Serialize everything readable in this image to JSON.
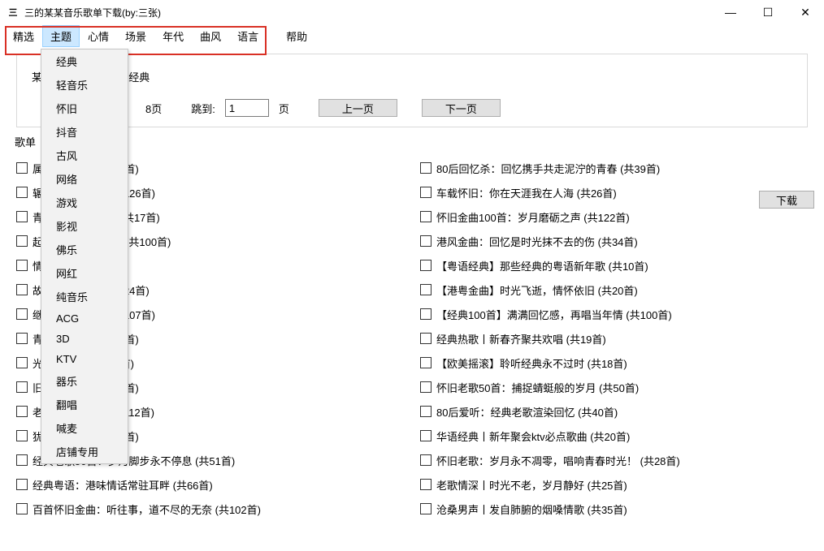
{
  "title": {
    "icon": "三",
    "text": "三的某某音乐歌单下载(by:三张)"
  },
  "win": {
    "min": "—",
    "max": "☐",
    "close": "✕"
  },
  "menubar": {
    "items": [
      "精选",
      "主题",
      "心情",
      "场景",
      "年代",
      "曲风",
      "语言",
      "帮助"
    ],
    "active_index": 1
  },
  "dropdown": {
    "items": [
      "经典",
      "轻音乐",
      "怀旧",
      "抖音",
      "古风",
      "网络",
      "游戏",
      "影视",
      "佛乐",
      "网红",
      "纯音乐",
      "ACG",
      "3D",
      "KTV",
      "器乐",
      "翻唱",
      "喊麦",
      "店铺专用"
    ]
  },
  "panel": {
    "header_prefix": "某某",
    "header_suffix": "经典",
    "page_info_suffix": "8页",
    "jump_label": "跳到:",
    "jump_value": "1",
    "page_suffix_label": "页",
    "prev_label": "上一页",
    "next_label": "下一页"
  },
  "list": {
    "header": "歌单",
    "download_label": "下载",
    "left": [
      "属的光辉岁月   (共32首)",
      "辗转往事岁月轴   (共126首)",
      "青春，遗漏的经典   (共17首)",
      "起高呼Rock 'n' Roll   (共100首)",
      "情至今难忘   (共20首)",
      "故人，谈笑风生   (共24首)",
      "继绻心间的回忆   (共107首)",
      "青涩年华往事   (共50首)",
      "光辉旧流年   (共148首)",
      "旧曲，念旧人   (共19首)",
      "老歌浸润旧年华   (共112首)",
      "犹耳际的回声   (共50首)",
      "经典老歌50首：岁月脚步永不停息   (共51首)",
      "经典粤语：港味情话常驻耳畔   (共66首)",
      "百首怀旧金曲：听往事，道不尽的无奈   (共102首)"
    ],
    "right": [
      "80后回忆杀：回忆携手共走泥泞的青春   (共39首)",
      "车载怀旧：你在天涯我在人海   (共26首)",
      "怀旧金曲100首：岁月磨砺之声   (共122首)",
      "港风金曲：回忆是时光抹不去的伤   (共34首)",
      "【粤语经典】那些经典的粤语新年歌   (共10首)",
      "【港粤金曲】时光飞逝，情怀依旧   (共20首)",
      "【经典100首】满满回忆感，再唱当年情   (共100首)",
      "经典热歌丨新春齐聚共欢唱   (共19首)",
      "【欧美摇滚】聆听经典永不过时   (共18首)",
      "怀旧老歌50首：捕捉蜻蜓般的岁月   (共50首)",
      "80后爱听：经典老歌渲染回忆   (共40首)",
      "华语经典丨新年聚会ktv必点歌曲   (共20首)",
      "怀旧老歌：岁月永不凋零，唱响青春时光！   (共28首)",
      "老歌情深丨时光不老，岁月静好   (共25首)",
      "沧桑男声丨发自肺腑的烟嗓情歌   (共35首)"
    ]
  }
}
